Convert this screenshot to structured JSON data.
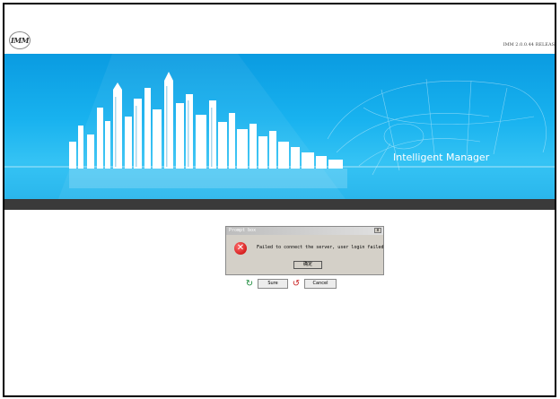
{
  "app": {
    "logo_text": "IMM",
    "version": "IMM 2.0.0.44 RELEAS"
  },
  "banner": {
    "title": "Intelligent Manager",
    "colors": {
      "sky_top": "#0a9be1",
      "sky_bottom": "#35c3f4",
      "strip": "#3a3a3a"
    }
  },
  "dialog": {
    "title": "Prompt box",
    "close_label": "x",
    "message": "Failed to connect the server, user login failed",
    "ok_label": "确定",
    "icon": "error-icon"
  },
  "actions": {
    "sure_label": "Sure",
    "cancel_label": "Cancel",
    "sure_icon": "refresh-icon",
    "cancel_icon": "undo-icon"
  }
}
